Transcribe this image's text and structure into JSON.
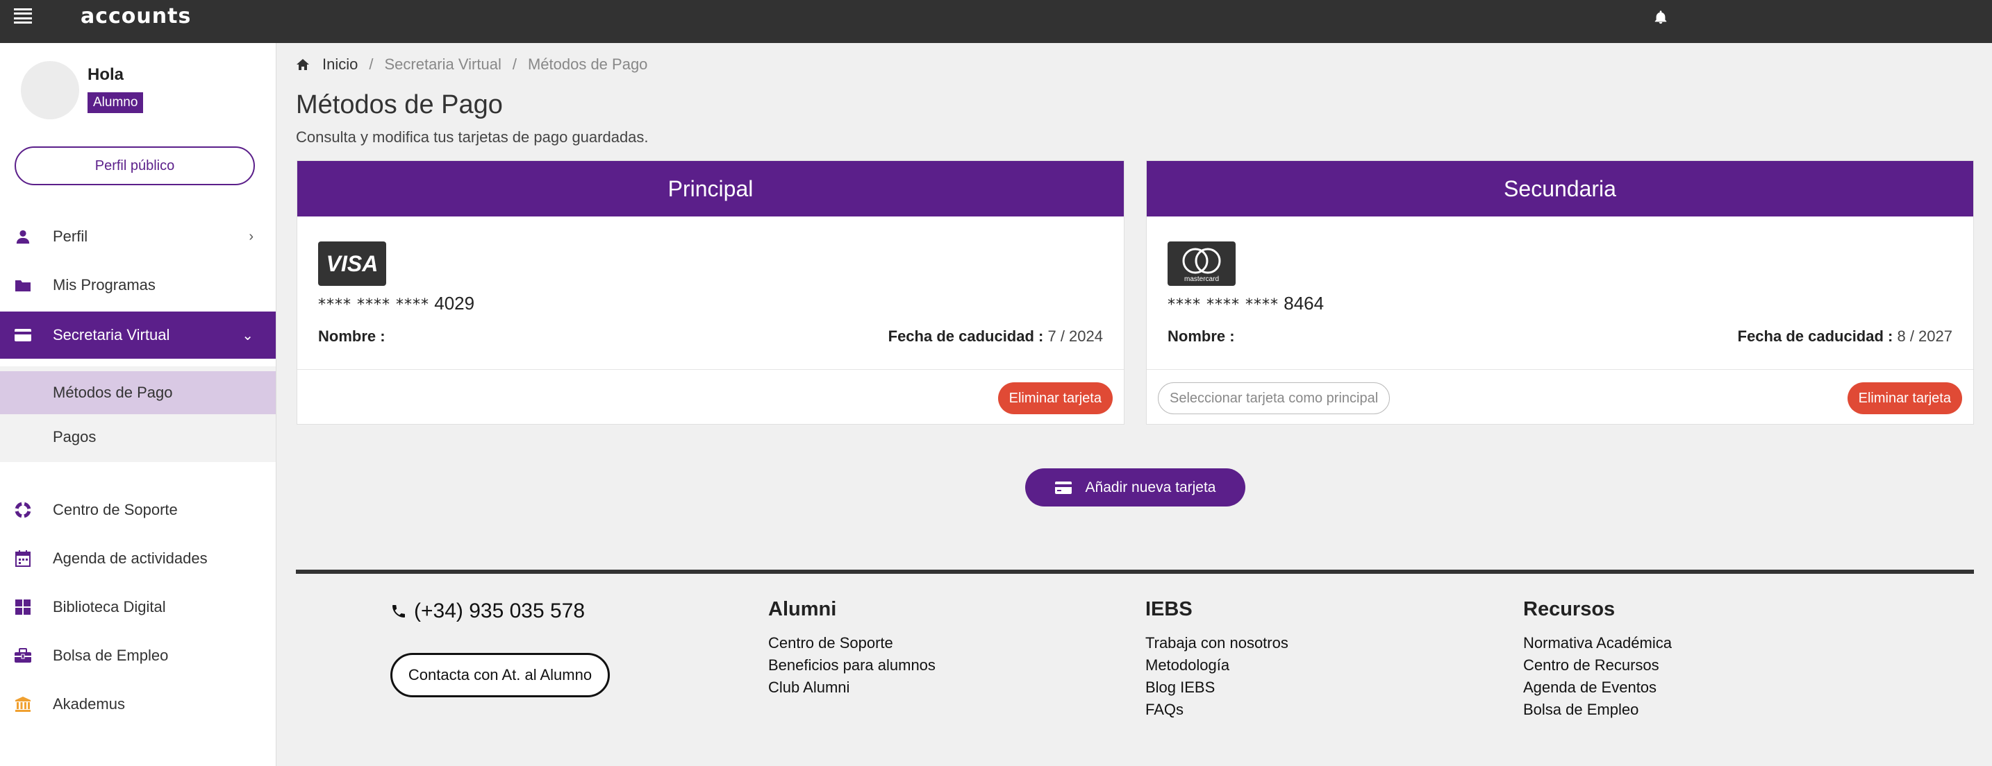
{
  "app": {
    "logo": "accounts"
  },
  "sidebar": {
    "greeting": "Hola",
    "role": "Alumno",
    "profile_button": "Perfil público",
    "items": [
      {
        "label": "Perfil",
        "icon": "user-icon",
        "chevron": "›"
      },
      {
        "label": "Mis Programas",
        "icon": "folder-icon"
      },
      {
        "label": "Secretaria Virtual",
        "icon": "credit-card-icon",
        "chevron": "⌄",
        "active": true
      },
      {
        "label": "Centro de Soporte",
        "icon": "lifebuoy-icon"
      },
      {
        "label": "Agenda de actividades",
        "icon": "calendar-icon"
      },
      {
        "label": "Biblioteca Digital",
        "icon": "grid-icon"
      },
      {
        "label": "Bolsa de Empleo",
        "icon": "briefcase-icon"
      },
      {
        "label": "Akademus",
        "icon": "institution-icon"
      }
    ],
    "subitems": [
      {
        "label": "Métodos de Pago",
        "active": true
      },
      {
        "label": "Pagos"
      }
    ]
  },
  "breadcrumb": {
    "items": [
      "Inicio",
      "Secretaria Virtual",
      "Métodos de Pago"
    ],
    "separator": "/"
  },
  "page": {
    "title": "Métodos de Pago",
    "subtitle": "Consulta y modifica tus tarjetas de pago guardadas."
  },
  "cards": [
    {
      "header": "Principal",
      "brand": "VISA",
      "mask": "**** **** ****",
      "last4": "4029",
      "name_label": "Nombre :",
      "expiry_label": "Fecha de caducidad :",
      "expiry_value": "7 / 2024",
      "delete_label": "Eliminar tarjeta"
    },
    {
      "header": "Secundaria",
      "brand": "mastercard",
      "mask": "**** **** ****",
      "last4": "8464",
      "name_label": "Nombre :",
      "expiry_label": "Fecha de caducidad :",
      "expiry_value": "8 / 2027",
      "make_main_label": "Seleccionar tarjeta como principal",
      "delete_label": "Eliminar tarjeta"
    }
  ],
  "add_card_button": "Añadir nueva tarjeta",
  "footer": {
    "phone": "(+34) 935 035 578",
    "contact_button": "Contacta con At. al Alumno",
    "columns": [
      {
        "title": "Alumni",
        "links": [
          "Centro de Soporte",
          "Beneficios para alumnos",
          "Club Alumni"
        ]
      },
      {
        "title": "IEBS",
        "links": [
          "Trabaja con nosotros",
          "Metodología",
          "Blog IEBS",
          "FAQs"
        ]
      },
      {
        "title": "Recursos",
        "links": [
          "Normativa Académica",
          "Centro de Recursos",
          "Agenda de Eventos",
          "Bolsa de Empleo"
        ]
      }
    ]
  },
  "colors": {
    "brand_purple": "#5b1f8a",
    "danger": "#e04a35",
    "topbar": "#323232",
    "submenu_active": "#d9c9e4",
    "icon_orange": "#f0a030"
  }
}
